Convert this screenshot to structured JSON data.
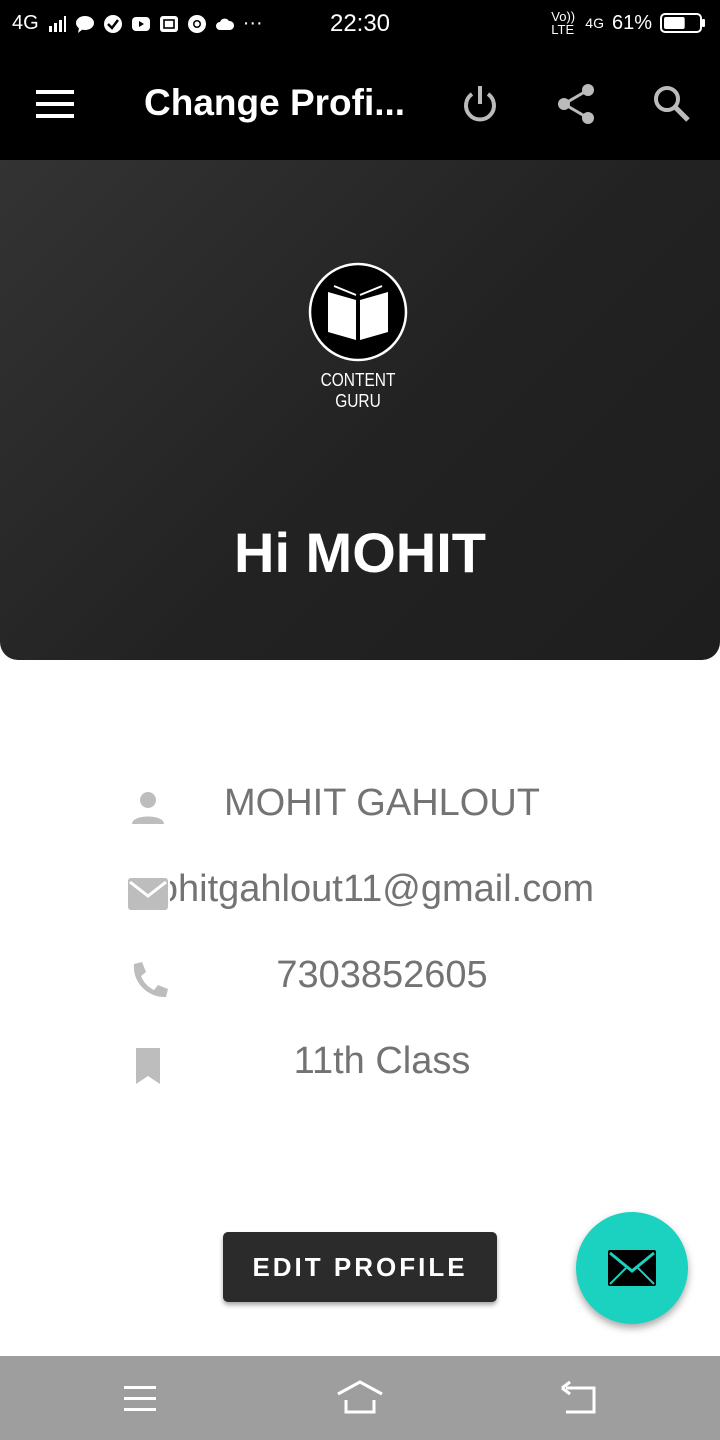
{
  "status_bar": {
    "network": "4G",
    "time": "22:30",
    "volte": "Vo)) LTE",
    "data_type": "4G",
    "battery": "61%",
    "battery_level": 0.61,
    "more": "···"
  },
  "toolbar": {
    "title": "Change Profi...",
    "icons": [
      "menu-icon",
      "power-icon",
      "share-icon",
      "search-icon"
    ]
  },
  "header": {
    "logo_text": "CONTENT GURU",
    "greeting": "Hi MOHIT"
  },
  "profile": {
    "name": "MOHIT GAHLOUT",
    "email": "mohitgahlout11@gmail.com",
    "phone": "7303852605",
    "class": "11th Class"
  },
  "actions": {
    "edit_label": "EDIT PROFILE"
  },
  "colors": {
    "fab": "#1ad2bf",
    "toolbar": "#000000",
    "card": "#2a2a2a",
    "text_secondary": "#737373"
  }
}
